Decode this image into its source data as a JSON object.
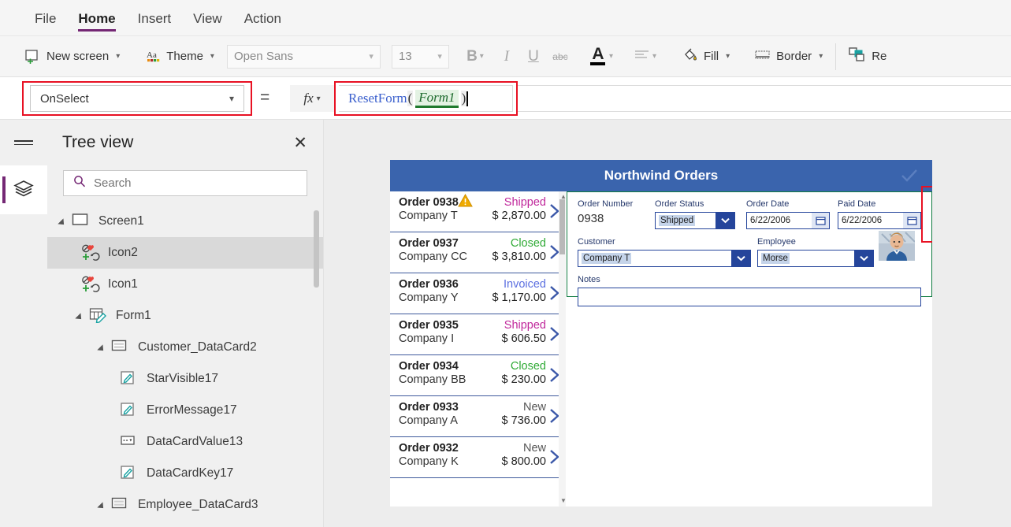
{
  "ribbon": {
    "tabs": [
      {
        "label": "File",
        "active": false
      },
      {
        "label": "Home",
        "active": true
      },
      {
        "label": "Insert",
        "active": false
      },
      {
        "label": "View",
        "active": false
      },
      {
        "label": "Action",
        "active": false
      }
    ]
  },
  "toolbar": {
    "new_screen": "New screen",
    "theme": "Theme",
    "font_family": "Open Sans",
    "font_size": "13",
    "bold": "B",
    "italic": "I",
    "underline": "U",
    "strikethrough": "abc",
    "font_color": "A",
    "align": "align-left",
    "fill": "Fill",
    "border": "Border",
    "reorder": "Re"
  },
  "formula_bar": {
    "property": "OnSelect",
    "equals": "=",
    "fx": "fx",
    "formula_function": "ResetForm",
    "formula_open_paren": "(",
    "formula_arg": "Form1",
    "formula_close_paren": ")",
    "formula_full": "ResetForm( Form1 )"
  },
  "tree_view": {
    "title": "Tree view",
    "close": "✕",
    "search_placeholder": "Search",
    "search_value": "",
    "nodes": [
      {
        "label": "Screen1",
        "indent": 0,
        "icon": "screen-icon",
        "twisty": true,
        "selected": false
      },
      {
        "label": "Icon2",
        "indent": 1,
        "icon": "icon-group-icon",
        "twisty": false,
        "selected": true
      },
      {
        "label": "Icon1",
        "indent": 1,
        "icon": "icon-group-icon",
        "twisty": false,
        "selected": false
      },
      {
        "label": "Form1",
        "indent": 1,
        "icon": "form-icon",
        "twisty": true,
        "selected": false
      },
      {
        "label": "Customer_DataCard2",
        "indent": 2,
        "icon": "datacard-icon",
        "twisty": true,
        "selected": false
      },
      {
        "label": "StarVisible17",
        "indent": 3,
        "icon": "label-icon",
        "twisty": false,
        "selected": false
      },
      {
        "label": "ErrorMessage17",
        "indent": 3,
        "icon": "label-icon",
        "twisty": false,
        "selected": false
      },
      {
        "label": "DataCardValue13",
        "indent": 3,
        "icon": "dropdown-icon",
        "twisty": false,
        "selected": false
      },
      {
        "label": "DataCardKey17",
        "indent": 3,
        "icon": "label-icon",
        "twisty": false,
        "selected": false
      },
      {
        "label": "Employee_DataCard3",
        "indent": 2,
        "icon": "datacard-icon",
        "twisty": true,
        "selected": false
      }
    ]
  },
  "app_preview": {
    "title": "Northwind Orders",
    "header_color": "#3a64ad",
    "gallery": [
      {
        "order": "Order 0938",
        "company": "Company T",
        "status": "Shipped",
        "amount": "$ 2,870.00",
        "warning": true
      },
      {
        "order": "Order 0937",
        "company": "Company CC",
        "status": "Closed",
        "amount": "$ 3,810.00",
        "warning": false
      },
      {
        "order": "Order 0936",
        "company": "Company Y",
        "status": "Invoiced",
        "amount": "$ 1,170.00",
        "warning": false
      },
      {
        "order": "Order 0935",
        "company": "Company I",
        "status": "Shipped",
        "amount": "$ 606.50",
        "warning": false
      },
      {
        "order": "Order 0934",
        "company": "Company BB",
        "status": "Closed",
        "amount": "$ 230.00",
        "warning": false
      },
      {
        "order": "Order 0933",
        "company": "Company A",
        "status": "New",
        "amount": "$ 736.00",
        "warning": false
      },
      {
        "order": "Order 0932",
        "company": "Company K",
        "status": "New",
        "amount": "$ 800.00",
        "warning": false
      }
    ],
    "form": {
      "order_number_label": "Order Number",
      "order_number_value": "0938",
      "order_status_label": "Order Status",
      "order_status_value": "Shipped",
      "order_date_label": "Order Date",
      "order_date_value": "6/22/2006",
      "paid_date_label": "Paid Date",
      "paid_date_value": "6/22/2006",
      "customer_label": "Customer",
      "customer_value": "Company T",
      "employee_label": "Employee",
      "employee_value": "Morse",
      "notes_label": "Notes",
      "notes_value": ""
    }
  },
  "colors": {
    "accent": "#742774",
    "highlight_outline": "#e81123",
    "app_header": "#3a64ad",
    "form_select": "#107c41",
    "field_border": "#25459b"
  }
}
